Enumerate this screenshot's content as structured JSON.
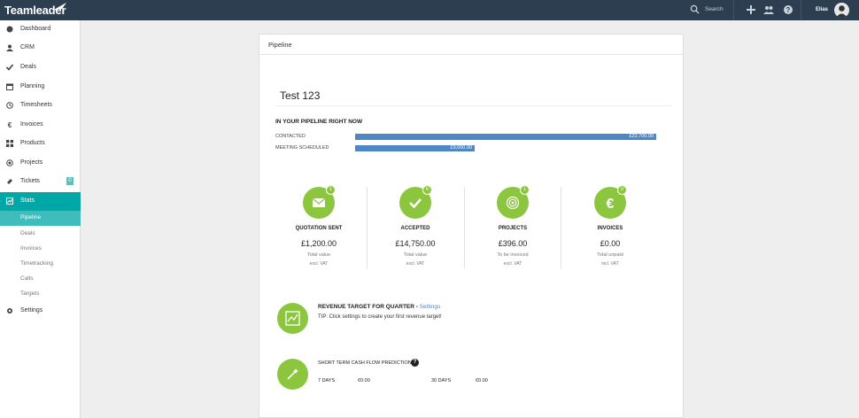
{
  "app": {
    "logo_text": "Teamleader",
    "search_label": "Search",
    "user_name": "Elias"
  },
  "sidebar": {
    "items": [
      {
        "label": "Dashboard",
        "icon": "dashboard-icon"
      },
      {
        "label": "CRM",
        "icon": "person-icon"
      },
      {
        "label": "Deals",
        "icon": "check-icon"
      },
      {
        "label": "Planning",
        "icon": "calendar-icon"
      },
      {
        "label": "Timesheets",
        "icon": "clock-icon"
      },
      {
        "label": "Invoices",
        "icon": "euro-icon"
      },
      {
        "label": "Products",
        "icon": "grid-icon"
      },
      {
        "label": "Projects",
        "icon": "target-icon"
      },
      {
        "label": "Tickets",
        "icon": "ticket-icon",
        "badge": "0"
      },
      {
        "label": "Stats",
        "icon": "stats-icon"
      }
    ],
    "stats_sub": [
      "Pipeline",
      "Deals",
      "Invoices",
      "Timetracking",
      "Calls",
      "Targets"
    ],
    "settings_label": "Settings"
  },
  "panel": {
    "header": "Pipeline",
    "title": "Test 123",
    "pipeline_heading": "IN YOUR PIPELINE RIGHT NOW",
    "stages": [
      {
        "label": "CONTACTED",
        "value": "£22,700.00",
        "amount": 22700
      },
      {
        "label": "MEETING SCHEDULED",
        "value": "£9,000.00",
        "amount": 9000
      }
    ],
    "kpis": [
      {
        "title": "QUOTATION SENT",
        "count": "1",
        "value": "£1,200.00",
        "sub": "Total value",
        "sub2": "excl. VAT",
        "icon": "envelope-icon"
      },
      {
        "title": "ACCEPTED",
        "count": "6",
        "value": "£14,750.00",
        "sub": "Total value",
        "sub2": "excl. VAT",
        "icon": "checkmark-icon"
      },
      {
        "title": "PROJECTS",
        "count": "1",
        "value": "£396.00",
        "sub": "To be invoiced",
        "sub2": "excl. VAT",
        "icon": "target-icon"
      },
      {
        "title": "INVOICES",
        "count": "0",
        "value": "£0.00",
        "sub": "Total unpaid",
        "sub2": "incl. VAT",
        "icon": "euro-icon"
      }
    ],
    "revenue": {
      "title": "REVENUE TARGET FOR QUARTER - ",
      "link": "Settings",
      "tip": "TIP: Click settings to create your first revenue target!"
    },
    "cashflow": {
      "title": "SHORT TERM CASH FLOW PREDICTION",
      "help": "?",
      "d7_label": "7 DAYS",
      "d7_value": "€0.00",
      "d30_label": "30 DAYS",
      "d30_value": "€0.00"
    }
  },
  "colors": {
    "topbar": "#2c3e50",
    "accent": "#00a7a7",
    "green": "#8cc63f",
    "bar": "#4f86c6"
  }
}
